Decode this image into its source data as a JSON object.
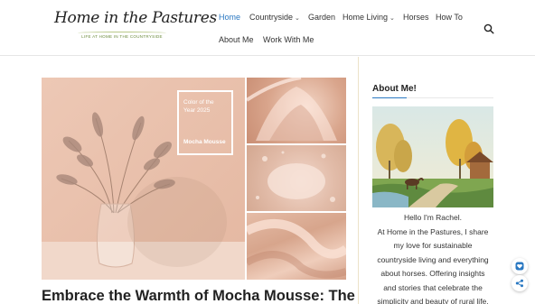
{
  "brand": {
    "title": "Home in the Pastures",
    "tagline": "LIFE AT HOME IN THE COUNTRYSIDE"
  },
  "nav": {
    "items": [
      {
        "label": "Home",
        "active": true
      },
      {
        "label": "Countryside",
        "has_dropdown": true
      },
      {
        "label": "Garden"
      },
      {
        "label": "Home Living",
        "has_dropdown": true
      },
      {
        "label": "Horses"
      },
      {
        "label": "How To"
      },
      {
        "label": "About Me"
      },
      {
        "label": "Work With Me"
      }
    ],
    "search_icon": "search-icon"
  },
  "featured": {
    "swatch": {
      "label": "Color of the Year 2025",
      "name": "Mocha Mousse"
    }
  },
  "post": {
    "title": "Embrace the Warmth of Mocha Mousse: The"
  },
  "sidebar": {
    "widget_title": "About Me!",
    "about_lines": [
      "Hello I'm Rachel.",
      "At Home in the Pastures, I share",
      "my love for sustainable",
      "countryside living and everything",
      "about horses. Offering insights",
      "and stories that celebrate the",
      "simplicity and beauty of rural life."
    ]
  },
  "floating_actions": {
    "heart_icon": "heart-icon",
    "share_icon": "share-icon"
  },
  "colors": {
    "accent": "#2a78c2",
    "mocha": "#e5b9a3",
    "sidebar_rule": "#ece2c8"
  }
}
